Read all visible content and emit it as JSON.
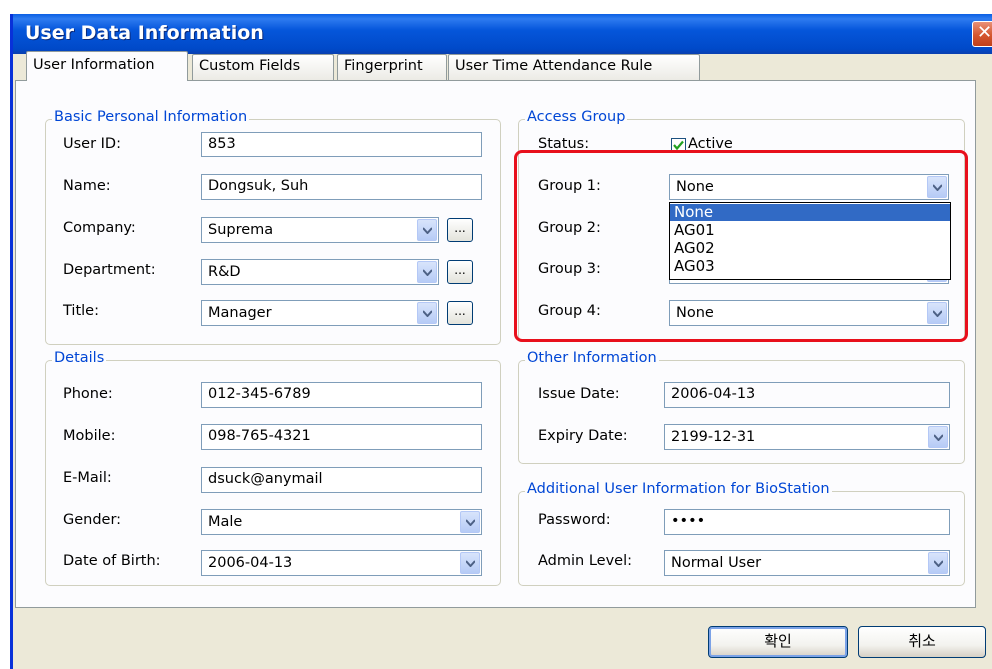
{
  "window": {
    "title": "User Data Information"
  },
  "tabs": [
    "User Information",
    "Custom Fields",
    "Fingerprint",
    "User Time Attendance Rule"
  ],
  "basic": {
    "legend": "Basic Personal Information",
    "user_id_label": "User ID:",
    "user_id": "853",
    "name_label": "Name:",
    "name": "Dongsuk, Suh",
    "company_label": "Company:",
    "company": "Suprema",
    "department_label": "Department:",
    "department": "R&D",
    "title_label": "Title:",
    "title": "Manager",
    "browse": "..."
  },
  "access": {
    "legend": "Access Group",
    "status_label": "Status:",
    "active_label": "Active",
    "active_checked": true,
    "group1_label": "Group 1:",
    "group1": "None",
    "group2_label": "Group 2:",
    "group3_label": "Group 3:",
    "group4_label": "Group 4:",
    "group4": "None",
    "dropdown_options": [
      "None",
      "AG01",
      "AG02",
      "AG03"
    ],
    "dropdown_selected": "None"
  },
  "details": {
    "legend": "Details",
    "phone_label": "Phone:",
    "phone": "012-345-6789",
    "mobile_label": "Mobile:",
    "mobile": "098-765-4321",
    "email_label": "E-Mail:",
    "email": "dsuck@anymail",
    "gender_label": "Gender:",
    "gender": "Male",
    "dob_label": "Date of Birth:",
    "dob": "2006-04-13"
  },
  "other": {
    "legend": "Other Information",
    "issue_label": "Issue Date:",
    "issue": "2006-04-13",
    "expiry_label": "Expiry Date:",
    "expiry": "2199-12-31"
  },
  "biostation": {
    "legend": "Additional User Information for BioStation",
    "password_label": "Password:",
    "password": "••••",
    "admin_label": "Admin Level:",
    "admin": "Normal User"
  },
  "buttons": {
    "ok": "확인",
    "cancel": "취소"
  },
  "colors": {
    "title_bar": "#0556DB",
    "highlight": "#E8101C",
    "selection": "#316AC5"
  }
}
